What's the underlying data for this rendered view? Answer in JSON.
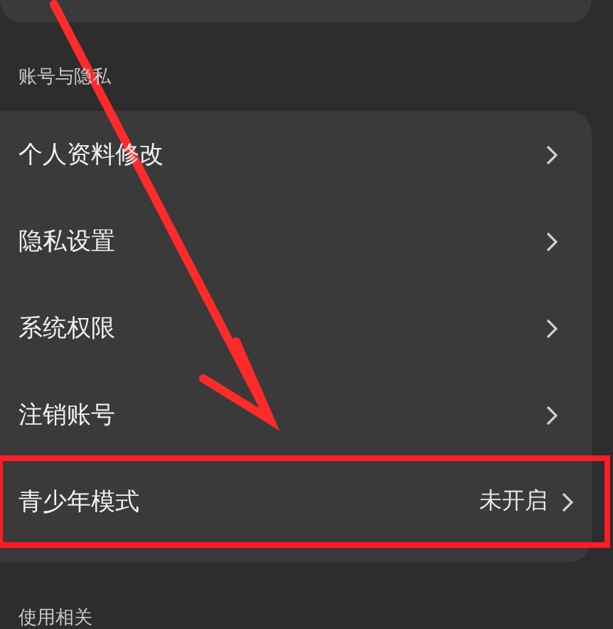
{
  "sections": [
    {
      "title": "账号与隐私",
      "items": [
        {
          "label": "个人资料修改",
          "highlighted": false
        },
        {
          "label": "隐私设置",
          "highlighted": false
        },
        {
          "label": "系统权限",
          "highlighted": false
        },
        {
          "label": "注销账号",
          "highlighted": false
        },
        {
          "label": "青少年模式",
          "value": "未开启",
          "highlighted": true
        }
      ]
    },
    {
      "title": "使用相关"
    }
  ]
}
